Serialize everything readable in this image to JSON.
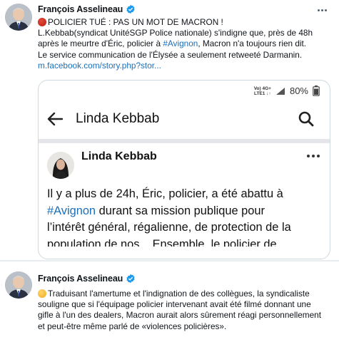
{
  "tweets": [
    {
      "author": "François Asselineau",
      "verified": true,
      "text_lines": [
        "POLICIER TUÉ : PAS UN MOT DE MACRON !",
        "L.Kebbab(syndicat UnitéSGP Police nationale) s'indigne que, près de 48h",
        " après le meurtre d'Éric, policier à ",
        "#Avignon",
        ", Macron n'a toujours rien dit.",
        "Le service communication de l'Élysée a seulement retweeté Darmanin.",
        "m.facebook.com/story.php?stor..."
      ],
      "card": {
        "status": {
          "network_top": "Vo) 4G+",
          "network_bottom": "LTE1 ↓↑",
          "battery": "80%"
        },
        "search_title": "Linda Kebbab",
        "post_author": "Linda Kebbab",
        "post_lines": [
          "Il y a plus de 24h, Éric, policier, a été abattu à",
          "#Avignon",
          " durant sa mission publique pour",
          "l’intérêt général, régalienne, de protection de la",
          "population de nos... Ensemble, le policier de..."
        ]
      }
    },
    {
      "author": "François Asselineau",
      "verified": true,
      "text_lines": [
        "Traduisant l'amertume et l'indignation de des collègues, la syndicaliste",
        "souligne que si l'équipage policier intervenant avait été filmé donnant une",
        "gifle à l'un des dealers, Macron aurait alors sûrement réagi personnellement",
        "et peut-être même parlé de «violences policières»."
      ]
    }
  ],
  "colors": {
    "link": "#1d6fb8",
    "verified": "#1d9bf0",
    "divider": "#e6ecf0"
  },
  "icons": [
    "red-circle-emoji",
    "verified-badge-icon",
    "more-icon",
    "back-arrow-icon",
    "search-icon",
    "signal-icon",
    "battery-icon",
    "worried-face-emoji"
  ]
}
